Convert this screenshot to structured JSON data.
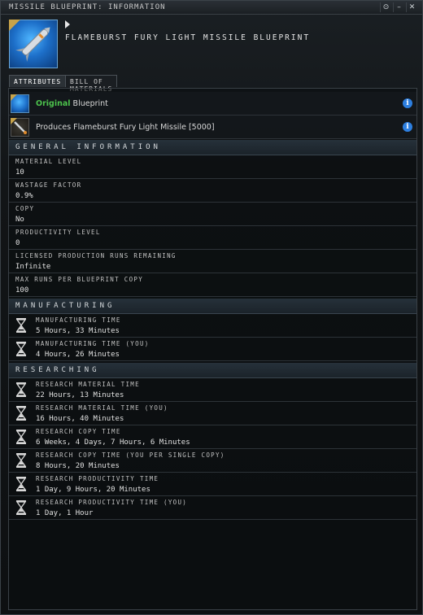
{
  "window": {
    "title": "MISSILE BLUEPRINT: INFORMATION",
    "buttons": [
      "⊙",
      "–",
      "✕"
    ]
  },
  "header": {
    "item_name": "FLAMEBURST FURY LIGHT MISSILE BLUEPRINT"
  },
  "tabs": [
    {
      "label": "ATTRIBUTES",
      "active": true
    },
    {
      "label": "BILL OF MATERIALS",
      "active": false
    }
  ],
  "info_rows": {
    "original": {
      "highlight": "Original",
      "text": "Blueprint"
    },
    "produces": {
      "text": "Produces Flameburst Fury Light Missile [5000]"
    },
    "info_icon": "i"
  },
  "general": {
    "header": "GENERAL INFORMATION",
    "rows": [
      {
        "label": "MATERIAL LEVEL",
        "value": "10"
      },
      {
        "label": "WASTAGE FACTOR",
        "value": "0.9%"
      },
      {
        "label": "COPY",
        "value": "No"
      },
      {
        "label": "PRODUCTIVITY LEVEL",
        "value": "0"
      },
      {
        "label": "LICENSED PRODUCTION RUNS REMAINING",
        "value": "Infinite"
      },
      {
        "label": "MAX RUNS PER BLUEPRINT COPY",
        "value": "100"
      }
    ]
  },
  "manufacturing": {
    "header": "MANUFACTURING",
    "rows": [
      {
        "label": "MANUFACTURING TIME",
        "value": "5 Hours, 33 Minutes"
      },
      {
        "label": "MANUFACTURING TIME (YOU)",
        "value": "4 Hours, 26 Minutes"
      }
    ]
  },
  "researching": {
    "header": "RESEARCHING",
    "rows": [
      {
        "label": "RESEARCH MATERIAL TIME",
        "value": "22 Hours, 13 Minutes"
      },
      {
        "label": "RESEARCH MATERIAL TIME (YOU)",
        "value": "16 Hours, 40 Minutes"
      },
      {
        "label": "RESEARCH COPY TIME",
        "value": "6 Weeks, 4 Days, 7 Hours, 6 Minutes"
      },
      {
        "label": "RESEARCH COPY TIME (YOU PER SINGLE COPY)",
        "value": "8 Hours, 20 Minutes"
      },
      {
        "label": "RESEARCH PRODUCTIVITY TIME",
        "value": "1 Day, 9 Hours, 20 Minutes"
      },
      {
        "label": "RESEARCH PRODUCTIVITY TIME (YOU)",
        "value": "1 Day, 1 Hour"
      }
    ]
  },
  "icons": {
    "blueprint": "blueprint-icon",
    "missile": "missile-icon",
    "time": "hourglass-icon",
    "info": "info-icon"
  },
  "colors": {
    "original_green": "#4cc24c",
    "info_blue": "#2d7fe0",
    "blueprint_gold": "#c7a34a"
  }
}
